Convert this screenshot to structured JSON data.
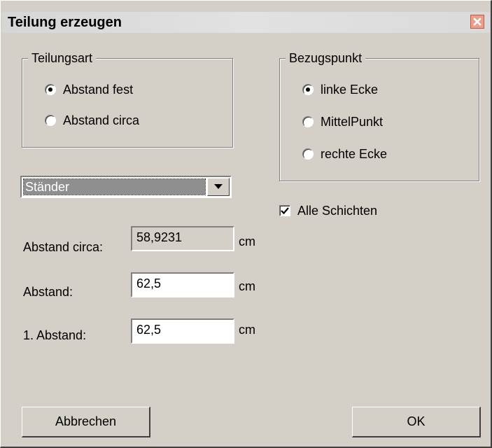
{
  "window": {
    "title": "Teilung erzeugen",
    "close_icon": "close-icon"
  },
  "teilungsart": {
    "label": "Teilungsart",
    "options": [
      {
        "label": "Abstand fest",
        "checked": true
      },
      {
        "label": "Abstand circa",
        "checked": false
      }
    ]
  },
  "bezugspunkt": {
    "label": "Bezugspunkt",
    "options": [
      {
        "label": "linke Ecke",
        "checked": true
      },
      {
        "label": "MittelPunkt",
        "checked": false
      },
      {
        "label": "rechte Ecke",
        "checked": false
      }
    ]
  },
  "type_select": {
    "value": "Ständer"
  },
  "alle_schichten": {
    "label": "Alle Schichten",
    "checked": true
  },
  "fields": [
    {
      "label": "Abstand circa:",
      "value": "58,9231",
      "unit": "cm",
      "readonly": true
    },
    {
      "label": "Abstand:",
      "value": "62,5",
      "unit": "cm",
      "readonly": false
    },
    {
      "label": "1. Abstand:",
      "value": "62,5",
      "unit": "cm",
      "readonly": false
    }
  ],
  "buttons": {
    "cancel": "Abbrechen",
    "ok": "OK"
  },
  "colors": {
    "dialog_bg": "#d4d0c8",
    "close_button": "#e8a08c"
  }
}
